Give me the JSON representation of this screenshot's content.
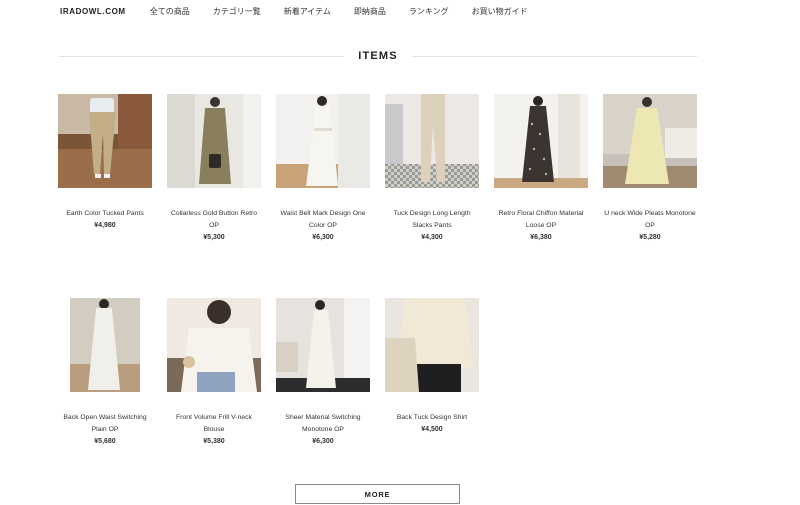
{
  "header": {
    "logo": "IRADOWL.COM",
    "nav": [
      {
        "label": "全ての商品"
      },
      {
        "label": "カテゴリ一覧"
      },
      {
        "label": "新着アイテム"
      },
      {
        "label": "即納商品"
      },
      {
        "label": "ランキング"
      },
      {
        "label": "お買い物ガイド"
      }
    ]
  },
  "section": {
    "title": "ITEMS"
  },
  "products": [
    {
      "name": "Earth Color Tucked Pants",
      "price": "¥4,980"
    },
    {
      "name": "Collarless Gold Button Retro OP",
      "price": "¥5,300"
    },
    {
      "name": "Waist Belt Mark Design One Color OP",
      "price": "¥6,300"
    },
    {
      "name": "Tuck Design Long Length Slacks Pants",
      "price": "¥4,300"
    },
    {
      "name": "Retro Floral Chiffon Material Loose OP",
      "price": "¥6,380"
    },
    {
      "name": "U neck Wide Pleats Monotone OP",
      "price": "¥5,280"
    },
    {
      "name": "Back Open Waist Switching Plain OP",
      "price": "¥5,680"
    },
    {
      "name": "Front Volume Frill V-neck Blouse",
      "price": "¥5,380"
    },
    {
      "name": "Sheer Material Switching Monotone OP",
      "price": "¥6,300"
    },
    {
      "name": "Back Tuck Design Shirt",
      "price": "¥4,500"
    }
  ],
  "more_button": {
    "label": "MORE"
  },
  "colors": {
    "text": "#222222",
    "rule": "#e2e2e2",
    "button_border": "#8a8a8a"
  }
}
